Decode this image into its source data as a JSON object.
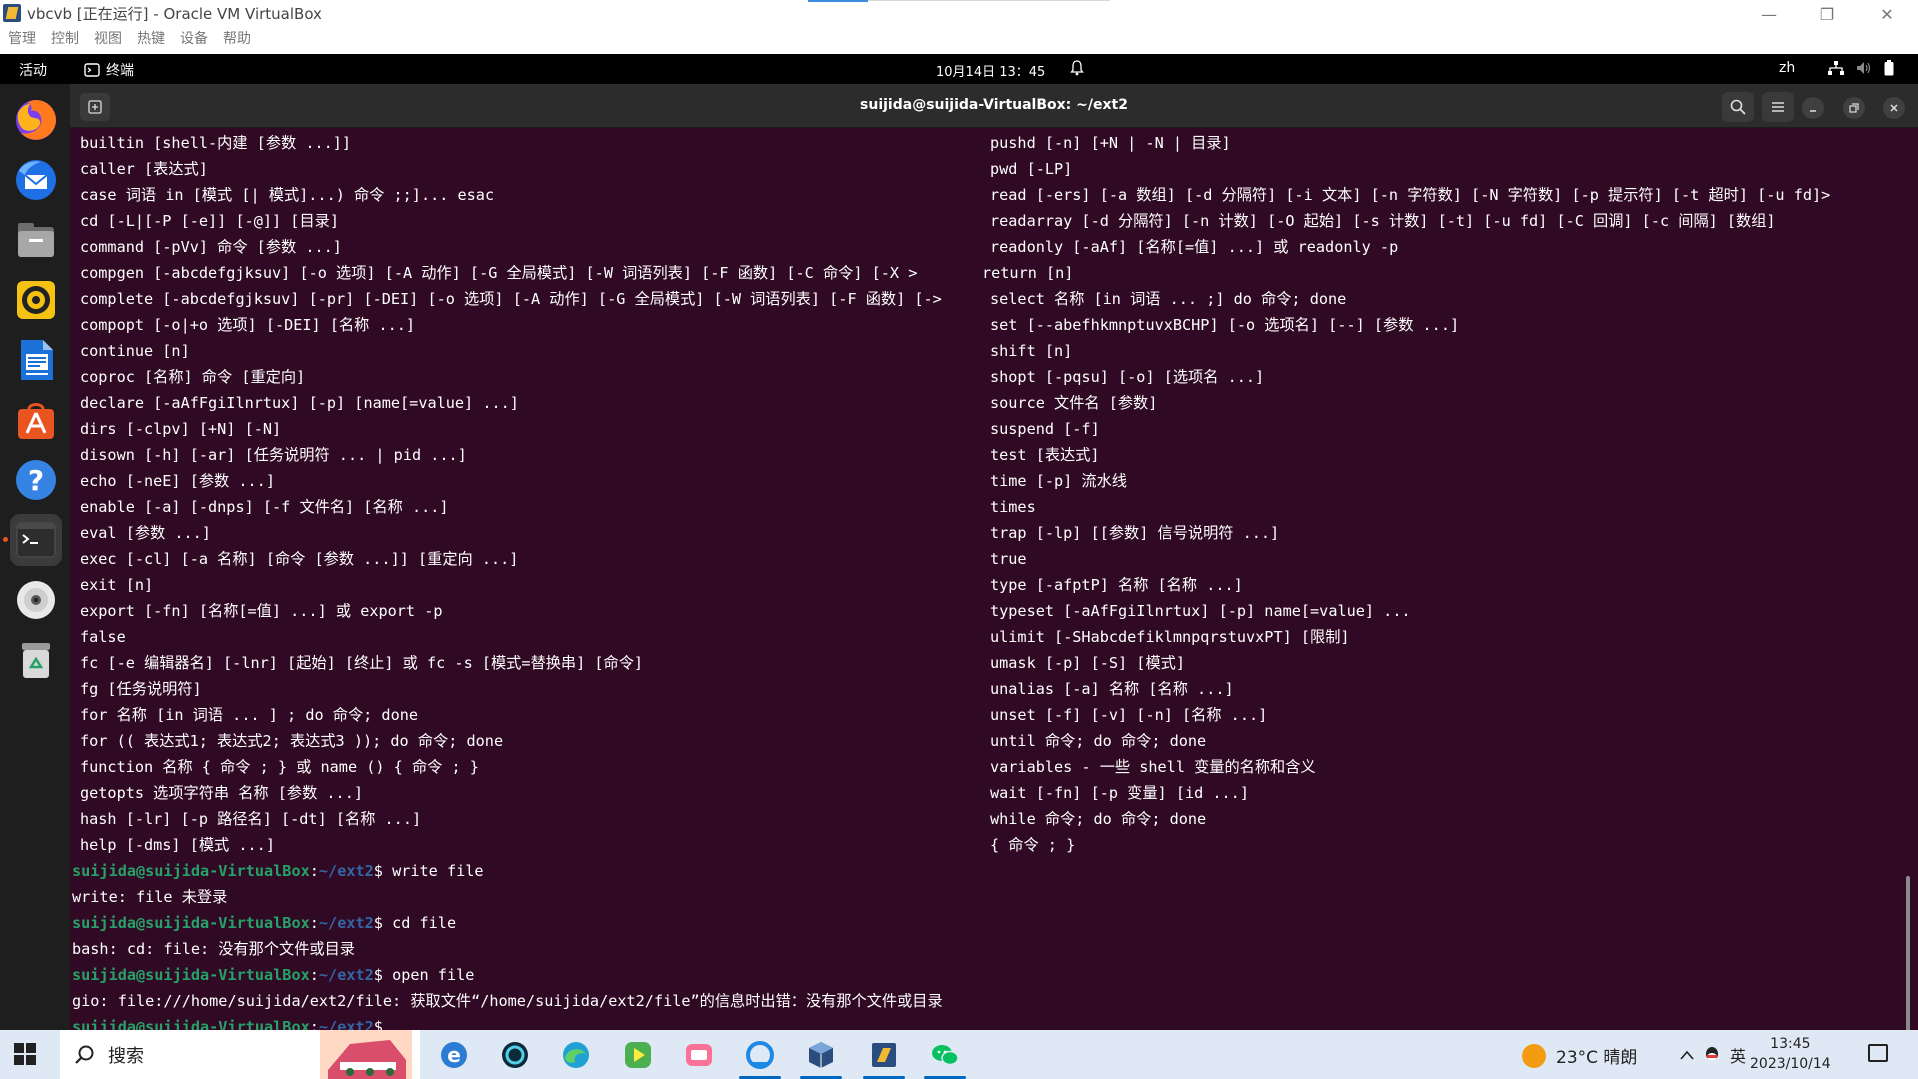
{
  "vbox": {
    "title": "vbcvb [正在运行] - Oracle VM VirtualBox",
    "menu": [
      "管理",
      "控制",
      "视图",
      "热键",
      "设备",
      "帮助"
    ]
  },
  "topbar": {
    "activities": "活动",
    "app_name": "终端",
    "clock": "10月14日 13：45",
    "lang": "zh"
  },
  "terminal": {
    "title": "suijida@suijida-VirtualBox: ~/ext2",
    "left_lines": [
      "builtin [shell-内建 [参数 ...]]",
      "caller [表达式]",
      "case 词语 in [模式 [| 模式]...) 命令 ;;]... esac",
      "cd [-L|[-P [-e]] [-@]] [目录]",
      "command [-pVv] 命令 [参数 ...]",
      "compgen [-abcdefgjksuv] [-o 选项] [-A 动作] [-G 全局模式] [-W 词语列表] [-F 函数] [-C 命令] [-X >",
      "complete [-abcdefgjksuv] [-pr] [-DEI] [-o 选项] [-A 动作] [-G 全局模式] [-W 词语列表] [-F 函数] [->",
      "compopt [-o|+o 选项] [-DEI] [名称 ...]",
      "continue [n]",
      "coproc [名称] 命令 [重定向]",
      "declare [-aAfFgiIlnrtux] [-p] [name[=value] ...]",
      "dirs [-clpv] [+N] [-N]",
      "disown [-h] [-ar] [任务说明符 ... | pid ...]",
      "echo [-neE] [参数 ...]",
      "enable [-a] [-dnps] [-f 文件名] [名称 ...]",
      "eval [参数 ...]",
      "exec [-cl] [-a 名称] [命令 [参数 ...]] [重定向 ...]",
      "exit [n]",
      "export [-fn] [名称[=值] ...] 或 export -p",
      "false",
      "fc [-e 编辑器名] [-lnr] [起始] [终止] 或 fc -s [模式=替换串] [命令]",
      "fg [任务说明符]",
      "for 名称 [in 词语 ... ] ; do 命令; done",
      "for (( 表达式1; 表达式2; 表达式3 )); do 命令; done",
      "function 名称 { 命令 ; } 或 name () { 命令 ; }",
      "getopts 选项字符串 名称 [参数 ...]",
      "hash [-lr] [-p 路径名] [-dt] [名称 ...]",
      "help [-dms] [模式 ...]"
    ],
    "right_lines": [
      "pushd [-n] [+N | -N | 目录]",
      "pwd [-LP]",
      "read [-ers] [-a 数组] [-d 分隔符] [-i 文本] [-n 字符数] [-N 字符数] [-p 提示符] [-t 超时] [-u fd]>",
      "readarray [-d 分隔符] [-n 计数] [-O 起始] [-s 计数] [-t] [-u fd] [-C 回调] [-c 间隔] [数组]",
      "readonly [-aAf] [名称[=值] ...] 或 readonly -p",
      "return [n]",
      "select 名称 [in 词语 ... ;] do 命令; done",
      "set [--abefhkmnptuvxBCHP] [-o 选项名] [--] [参数 ...]",
      "shift [n]",
      "shopt [-pqsu] [-o] [选项名 ...]",
      "source 文件名 [参数]",
      "suspend [-f]",
      "test [表达式]",
      "time [-p] 流水线",
      "times",
      "trap [-lp] [[参数] 信号说明符 ...]",
      "true",
      "type [-afptP] 名称 [名称 ...]",
      "typeset [-aAfFgiIlnrtux] [-p] name[=value] ...",
      "ulimit [-SHabcdefiklmnpqrstuvxPT] [限制]",
      "umask [-p] [-S] [模式]",
      "unalias [-a] 名称 [名称 ...]",
      "unset [-f] [-v] [-n] [名称 ...]",
      "until 命令; do 命令; done",
      "variables - 一些 shell 变量的名称和含义",
      "wait [-fn] [-p 变量] [id ...]",
      "while 命令; do 命令; done",
      "{ 命令 ; }"
    ],
    "prompt_user": "suijida@suijida-VirtualBox",
    "prompt_sep": ":",
    "prompt_path": "~/ext2",
    "prompt_dollar": "$",
    "cmd1": " write file",
    "out1": "write: file 未登录",
    "cmd2": " cd file",
    "out2": "bash: cd: file: 没有那个文件或目录",
    "cmd3": " open file",
    "out3": "gio: file:///home/suijida/ext2/file: 获取文件“/home/suijida/ext2/file”的信息时出错：没有那个文件或目录"
  },
  "taskbar": {
    "search": "搜索",
    "weather": "23°C 晴朗",
    "ime": "英",
    "time": "13:45",
    "date": "2023/10/14"
  },
  "colors": {
    "terminal_bg": "#300a24",
    "prompt_green": "#26a269",
    "prompt_blue": "#3465a4",
    "ubuntu_orange": "#e95420"
  }
}
